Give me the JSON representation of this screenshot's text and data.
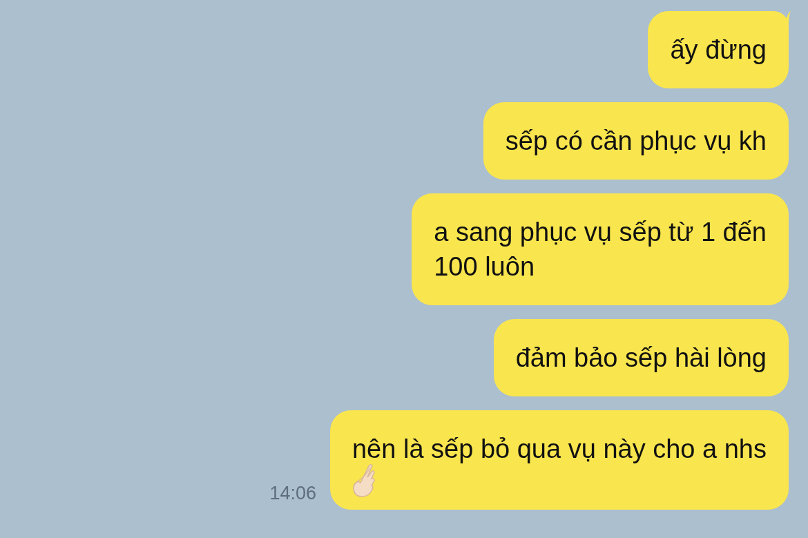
{
  "messages": [
    {
      "text": "ấy đừng",
      "kind": "text",
      "tail": true
    },
    {
      "text": "sếp có cần phục vụ kh",
      "kind": "text",
      "tail": false
    },
    {
      "text": "a sang phục vụ sếp từ 1 đến\n100 luôn",
      "kind": "text",
      "tail": false
    },
    {
      "text": "đảm bảo sếp hài lòng",
      "kind": "text",
      "tail": false
    },
    {
      "text": "nên là sếp bỏ qua vụ này cho a nhs",
      "kind": "text_with_hand",
      "tail": false,
      "time": "14:06"
    }
  ]
}
